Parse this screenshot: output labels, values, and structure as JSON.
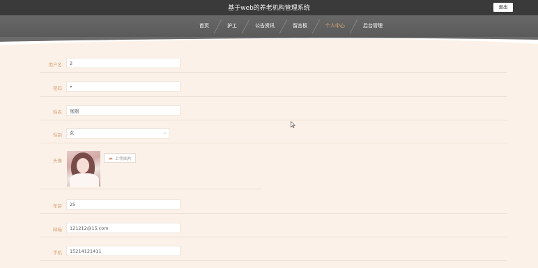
{
  "header": {
    "title": "基于web的养老机构管理系统",
    "logout_label": "退出"
  },
  "nav": {
    "items": [
      "首页",
      "护工",
      "公告资讯",
      "留言板",
      "个人中心",
      "后台管理"
    ],
    "active_index": 4
  },
  "form": {
    "username": {
      "label": "用户名",
      "value": "2"
    },
    "password": {
      "label": "密码",
      "value": "•"
    },
    "name": {
      "label": "姓名",
      "value": "张刚"
    },
    "gender": {
      "label": "性别",
      "value": "女"
    },
    "avatar": {
      "label": "头像",
      "upload_label": "上传图片"
    },
    "age": {
      "label": "年龄",
      "value": "25"
    },
    "email": {
      "label": "邮箱",
      "value": "121212@15.com"
    },
    "phone": {
      "label": "手机",
      "value": "15214121411"
    }
  },
  "colors": {
    "accent": "#d9a377",
    "background": "#fbf1e8",
    "topbar": "#3a3a3a",
    "navbar": "#606060"
  }
}
